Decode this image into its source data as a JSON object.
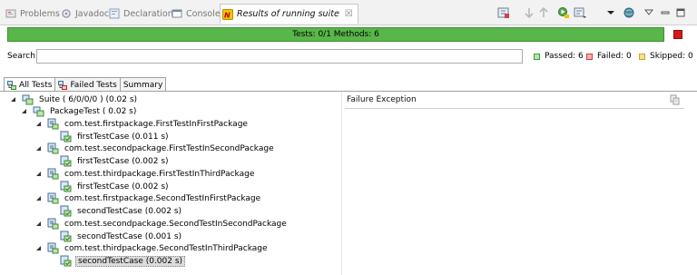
{
  "tabs": [
    {
      "label": "Problems",
      "icon": "problems-icon"
    },
    {
      "label": "Javadoc",
      "icon": "javadoc-icon"
    },
    {
      "label": "Declaration",
      "icon": "declaration-icon"
    },
    {
      "label": "Console",
      "icon": "console-icon"
    },
    {
      "label": "Results of running suite",
      "icon": "testng-icon",
      "close": "☒"
    }
  ],
  "progress": {
    "text": "Tests: 0/1  Methods: 6",
    "color": "#59b64a"
  },
  "search": {
    "label": "Search:",
    "value": ""
  },
  "stats": {
    "passed": "Passed: 6",
    "failed": "Failed: 0",
    "skipped": "Skipped: 0",
    "passed_color": "#3c9b3c",
    "failed_color": "#d23a3a",
    "skipped_color": "#d2a22a"
  },
  "subtabs": [
    "All Tests",
    "Failed Tests",
    "Summary"
  ],
  "tree": [
    {
      "label": "Suite ( 6/0/0/0 ) (0.02 s)"
    },
    {
      "label": "PackageTest ( 0.02 s)"
    },
    {
      "label": "com.test.firstpackage.FirstTestInFirstPackage"
    },
    {
      "label": "firstTestCase  (0.011 s)"
    },
    {
      "label": "com.test.secondpackage.FirstTestInSecondPackage"
    },
    {
      "label": "firstTestCase  (0.002 s)"
    },
    {
      "label": "com.test.thirdpackage.FirstTestInThirdPackage"
    },
    {
      "label": "firstTestCase  (0.002 s)"
    },
    {
      "label": "com.test.firstpackage.SecondTestInFirstPackage"
    },
    {
      "label": "secondTestCase  (0.002 s)"
    },
    {
      "label": "com.test.secondpackage.SecondTestInSecondPackage"
    },
    {
      "label": "secondTestCase  (0.001 s)"
    },
    {
      "label": "com.test.thirdpackage.SecondTestInThirdPackage"
    },
    {
      "label": "secondTestCase  (0.002 s)"
    }
  ],
  "failure": {
    "title": "Failure Exception"
  }
}
